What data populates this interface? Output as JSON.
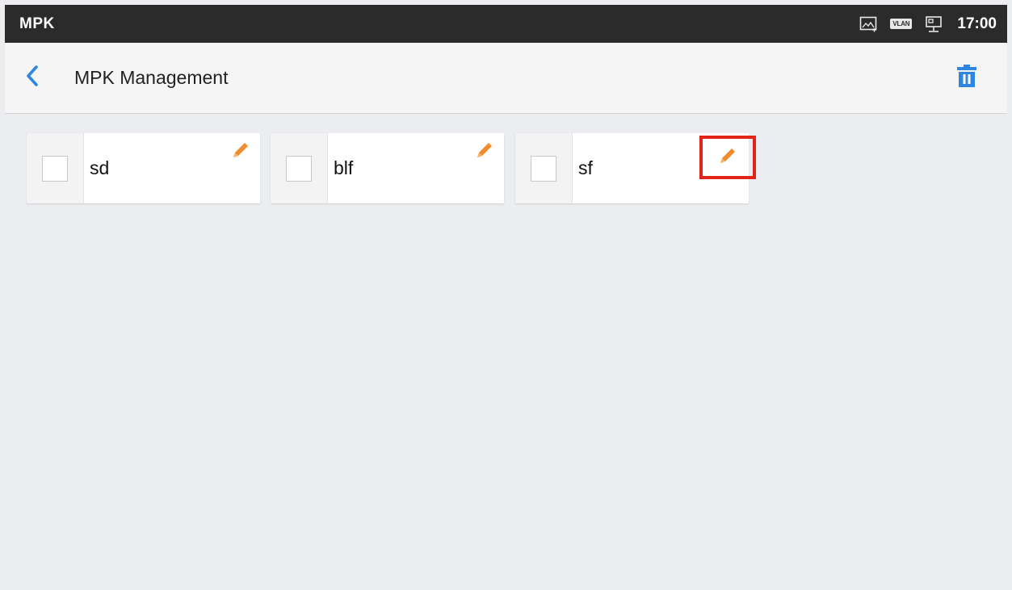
{
  "status_bar": {
    "app_name": "MPK",
    "time": "17:00",
    "icons": [
      "screenshot-icon",
      "vlan-icon",
      "ethernet-icon"
    ],
    "vlan_text": "VLAN"
  },
  "header": {
    "title": "MPK Management",
    "back_icon": "chevron-left-icon",
    "delete_icon": "trash-icon"
  },
  "mpk_items": [
    {
      "label": "sd",
      "checked": false,
      "highlighted": false
    },
    {
      "label": "blf",
      "checked": false,
      "highlighted": false
    },
    {
      "label": "sf",
      "checked": false,
      "highlighted": true
    }
  ],
  "colors": {
    "accent_blue": "#2f86e0",
    "edit_orange": "#f08c2e",
    "highlight_red": "#e2231a",
    "status_bar_bg": "#2b2b2b"
  }
}
